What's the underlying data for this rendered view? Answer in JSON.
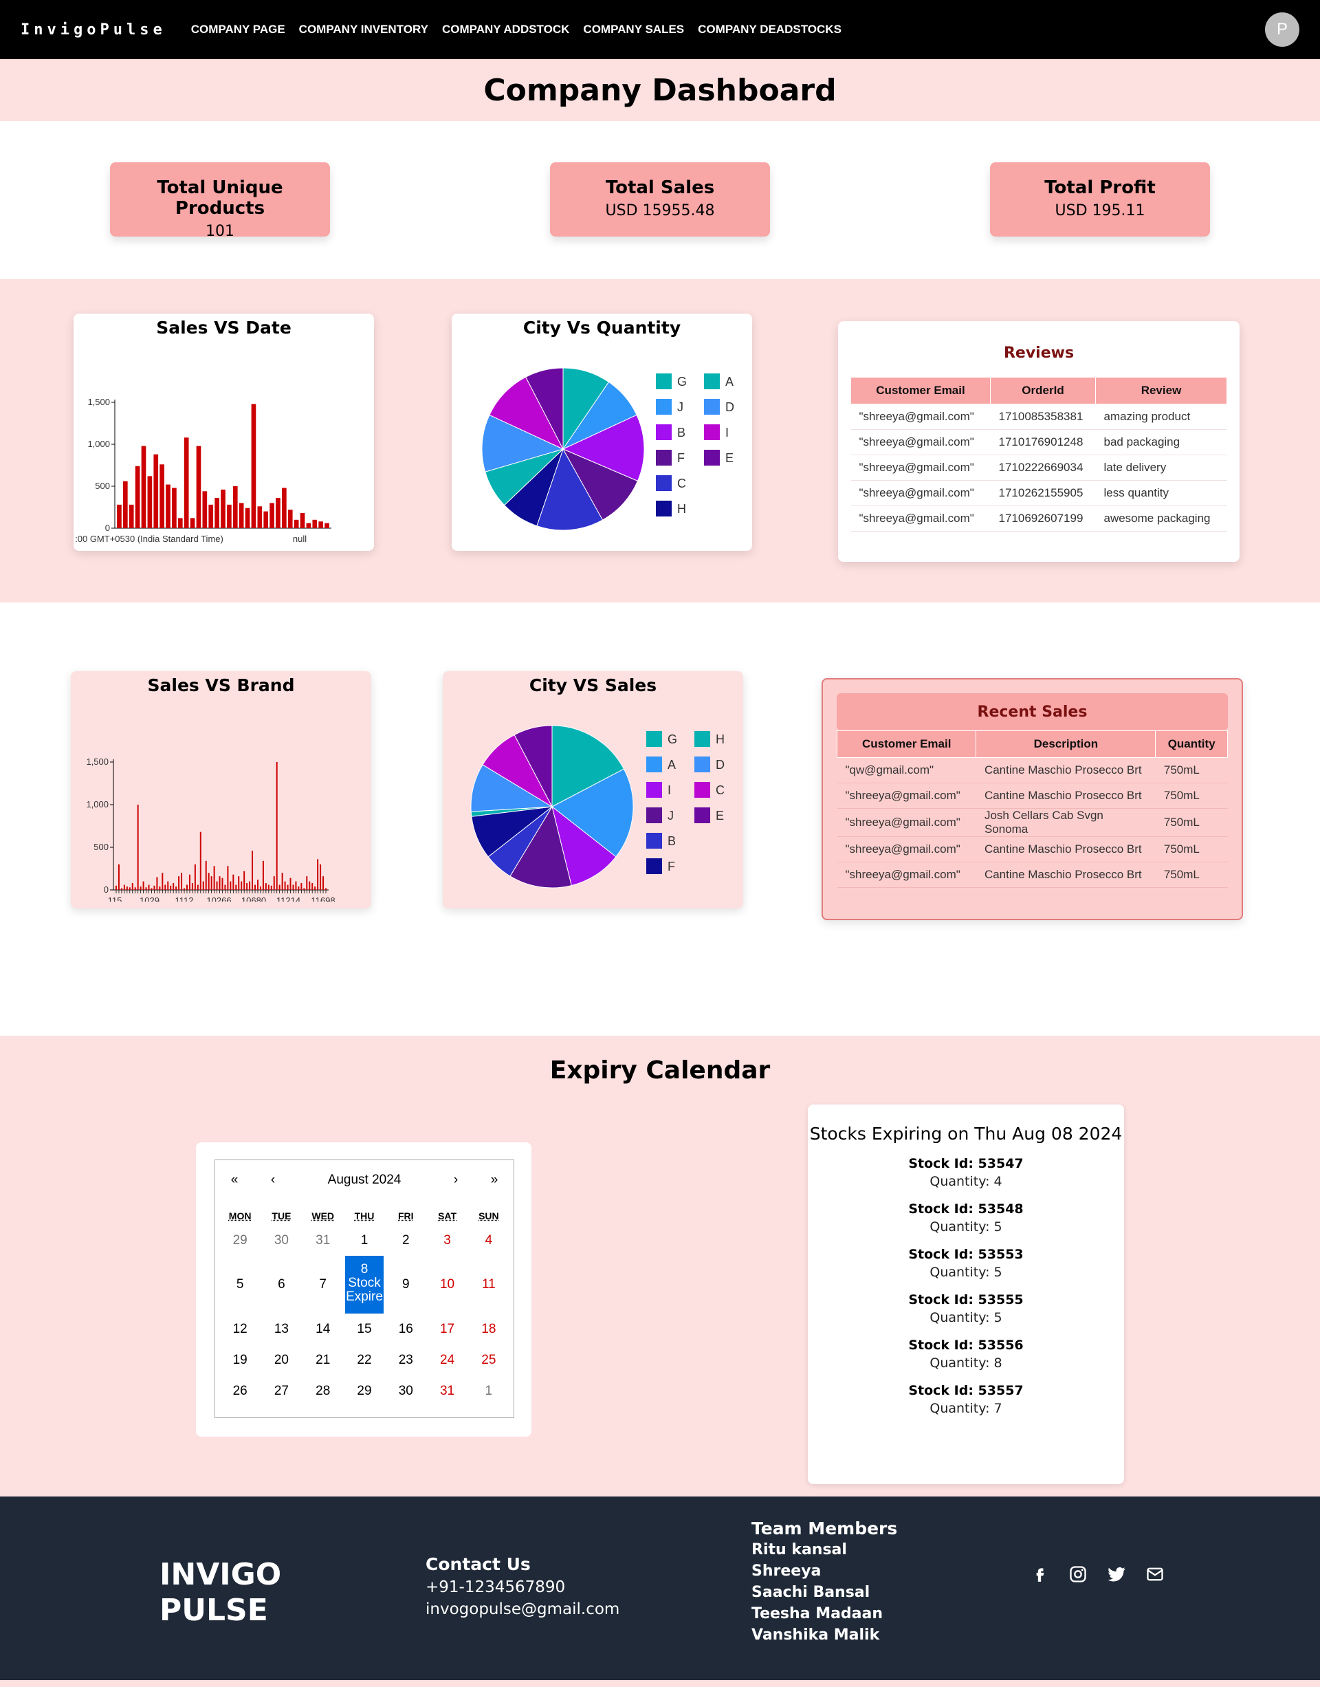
{
  "nav": {
    "brand": "InvigoPulse",
    "links": [
      "COMPANY PAGE",
      "COMPANY INVENTORY",
      "COMPANY ADDSTOCK",
      "COMPANY SALES",
      "COMPANY DEADSTOCKS"
    ],
    "avatar": "P"
  },
  "page_title": "Company Dashboard",
  "stats": [
    {
      "label": "Total Unique Products",
      "value": "101"
    },
    {
      "label": "Total Sales",
      "value": "USD 15955.48"
    },
    {
      "label": "Total Profit",
      "value": "USD 195.11"
    }
  ],
  "sales_vs_date": {
    "title": "Sales VS Date"
  },
  "city_vs_quantity": {
    "title": "City Vs Quantity"
  },
  "reviews": {
    "title": "Reviews",
    "columns": [
      "Customer Email",
      "OrderId",
      "Review"
    ],
    "rows": [
      [
        "\"shreeya@gmail.com\"",
        "1710085358381",
        "amazing product"
      ],
      [
        "\"shreeya@gmail.com\"",
        "1710176901248",
        "bad packaging"
      ],
      [
        "\"shreeya@gmail.com\"",
        "1710222669034",
        "late delivery"
      ],
      [
        "\"shreeya@gmail.com\"",
        "1710262155905",
        "less quantity"
      ],
      [
        "\"shreeya@gmail.com\"",
        "1710692607199",
        "awesome packaging"
      ]
    ]
  },
  "sales_vs_brand": {
    "title": "Sales VS Brand"
  },
  "city_vs_sales": {
    "title": "City VS Sales"
  },
  "recent_sales": {
    "title": "Recent Sales",
    "columns": [
      "Customer Email",
      "Description",
      "Quantity"
    ],
    "rows": [
      [
        "\"qw@gmail.com\"",
        "Cantine Maschio Prosecco Brt",
        "750mL"
      ],
      [
        "\"shreeya@gmail.com\"",
        "Cantine Maschio Prosecco Brt",
        "750mL"
      ],
      [
        "\"shreeya@gmail.com\"",
        "Josh Cellars Cab Svgn Sonoma",
        "750mL"
      ],
      [
        "\"shreeya@gmail.com\"",
        "Cantine Maschio Prosecco Brt",
        "750mL"
      ],
      [
        "\"shreeya@gmail.com\"",
        "Cantine Maschio Prosecco Brt",
        "750mL"
      ]
    ]
  },
  "expiry": {
    "title": "Expiry Calendar",
    "calendar": {
      "nav": [
        "«",
        "‹",
        "August 2024",
        "›",
        "»"
      ],
      "dow": [
        "MON",
        "TUE",
        "WED",
        "THU",
        "FRI",
        "SAT",
        "SUN"
      ],
      "weeks": [
        [
          "29",
          "30",
          "31",
          "1",
          "2",
          "3",
          "4"
        ],
        [
          "5",
          "6",
          "7",
          "8",
          "9",
          "10",
          "11"
        ],
        [
          "12",
          "13",
          "14",
          "15",
          "16",
          "17",
          "18"
        ],
        [
          "19",
          "20",
          "21",
          "22",
          "23",
          "24",
          "25"
        ],
        [
          "26",
          "27",
          "28",
          "29",
          "30",
          "31",
          "1"
        ]
      ],
      "selected_label": "Stock Expire"
    },
    "stocks_heading": "Stocks Expiring on Thu Aug 08 2024",
    "stocks": [
      {
        "id": "Stock Id: 53547",
        "qty": "Quantity: 4"
      },
      {
        "id": "Stock Id: 53548",
        "qty": "Quantity: 5"
      },
      {
        "id": "Stock Id: 53553",
        "qty": "Quantity: 5"
      },
      {
        "id": "Stock Id: 53555",
        "qty": "Quantity: 5"
      },
      {
        "id": "Stock Id: 53556",
        "qty": "Quantity: 8"
      },
      {
        "id": "Stock Id: 53557",
        "qty": "Quantity: 7"
      }
    ]
  },
  "footer": {
    "logo_line1": "INVIGO",
    "logo_line2": "PULSE",
    "contact_heading": "Contact Us",
    "phone": "+91-1234567890",
    "email": "invogopulse@gmail.com",
    "team_heading": "Team Members",
    "team": [
      "Ritu kansal",
      "Shreeya",
      "Saachi Bansal",
      "Teesha Madaan",
      "Vanshika Malik"
    ],
    "social_icons": [
      "facebook-icon",
      "instagram-icon",
      "twitter-icon",
      "mail-icon"
    ]
  },
  "chart_data": [
    {
      "type": "bar",
      "title": "Sales VS Date",
      "ylim": [
        0,
        1500
      ],
      "yticks": [
        "0",
        "500",
        "1,000",
        "1,500"
      ],
      "xtick_labels": [
        ":00 GMT+0530 (India Standard Time)",
        "null"
      ],
      "color": "#cc0000",
      "values": [
        280,
        560,
        280,
        740,
        980,
        620,
        880,
        760,
        520,
        480,
        120,
        1080,
        120,
        980,
        440,
        280,
        360,
        460,
        280,
        500,
        300,
        240,
        1480,
        260,
        200,
        300,
        360,
        480,
        220,
        100,
        180,
        60,
        100,
        80,
        60
      ]
    },
    {
      "type": "pie",
      "title": "City Vs Quantity",
      "categories": [
        "G",
        "J",
        "B",
        "F",
        "C",
        "H",
        "A",
        "D",
        "I",
        "E"
      ],
      "colors": {
        "G": "#05b2b2",
        "J": "#2f97fa",
        "B": "#a20ff0",
        "F": "#5d1195",
        "C": "#2e33ce",
        "H": "#0c0c94",
        "A": "#06b1b1",
        "D": "#3c91fa",
        "I": "#bb05d0",
        "E": "#6b0aa0"
      },
      "values": [
        10,
        9,
        14,
        11,
        14,
        8,
        8,
        12,
        11,
        8
      ]
    },
    {
      "type": "bar",
      "title": "Sales VS Brand",
      "ylim": [
        0,
        1500
      ],
      "yticks": [
        "0",
        "500",
        "1,000",
        "1,500"
      ],
      "xtick_labels": [
        "115",
        "1029",
        "1112",
        "10266",
        "10680",
        "11214",
        "11698"
      ],
      "color": "#cc0000",
      "values": [
        50,
        300,
        20,
        60,
        40,
        30,
        80,
        30,
        1000,
        40,
        100,
        30,
        60,
        20,
        50,
        150,
        40,
        200,
        60,
        100,
        50,
        80,
        40,
        160,
        200,
        20,
        60,
        180,
        80,
        300,
        60,
        680,
        100,
        340,
        200,
        160,
        280,
        100,
        160,
        140,
        60,
        280,
        100,
        180,
        60,
        160,
        100,
        220,
        80,
        100,
        460,
        60,
        120,
        40,
        340,
        80,
        60,
        50,
        160,
        1500,
        60,
        200,
        100,
        60,
        140,
        60,
        100,
        40,
        80,
        20,
        160,
        100,
        80,
        40,
        360,
        300,
        160,
        20
      ]
    },
    {
      "type": "pie",
      "title": "City VS Sales",
      "categories": [
        "G",
        "A",
        "I",
        "J",
        "B",
        "F",
        "H",
        "D",
        "C",
        "E"
      ],
      "colors": {
        "G": "#05b2b2",
        "A": "#2f97fa",
        "I": "#a20ff0",
        "J": "#5d1195",
        "B": "#2e33ce",
        "F": "#0c0c94",
        "H": "#06b1b1",
        "D": "#3c91fa",
        "C": "#bb05d0",
        "E": "#6b0aa0"
      },
      "values": [
        18,
        19,
        11,
        13,
        6,
        9,
        1,
        10,
        9,
        8
      ]
    }
  ]
}
